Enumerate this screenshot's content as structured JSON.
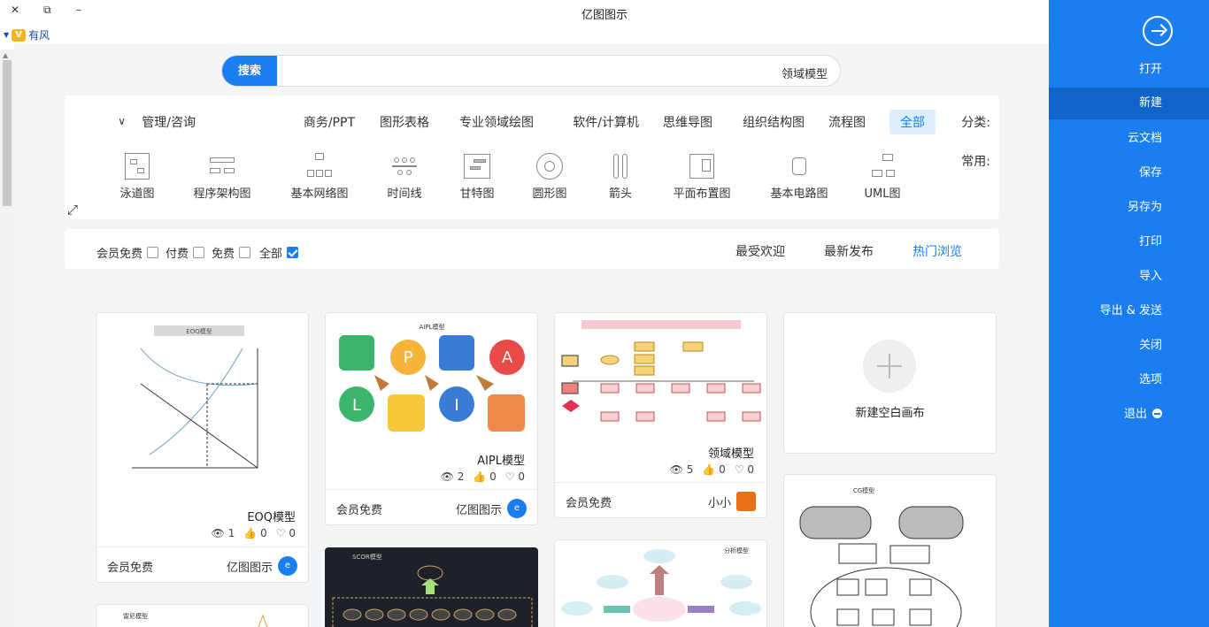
{
  "window": {
    "title": "亿图图示",
    "close": "✕",
    "restore": "⧉",
    "minimize": "–"
  },
  "brand": {
    "label": "有风",
    "logo": "V"
  },
  "search": {
    "button": "搜索",
    "query": "领域模型"
  },
  "categories": {
    "label": "分类:",
    "items": [
      "全部",
      "流程图",
      "组织结构图",
      "思维导图",
      "软件/计算机",
      "专业领域绘图",
      "图形表格",
      "商务/PPT",
      "管理/咨询"
    ],
    "more_icon": "chevron-down-icon"
  },
  "common": {
    "label": "常用:",
    "items": [
      "UML图",
      "基本电路图",
      "平面布置图",
      "箭头",
      "圆形图",
      "甘特图",
      "时间线",
      "基本网络图",
      "程序架构图",
      "泳道图"
    ]
  },
  "filters": {
    "tabs": [
      "热门浏览",
      "最新发布",
      "最受欢迎"
    ],
    "checks": [
      {
        "label": "全部",
        "checked": true
      },
      {
        "label": "免费",
        "checked": false
      },
      {
        "label": "付费",
        "checked": false
      },
      {
        "label": "会员免费",
        "checked": false
      }
    ]
  },
  "new_canvas": {
    "label": "新建空白画布"
  },
  "cards": [
    {
      "title": "领域模型",
      "views": "5",
      "likes": "0",
      "favs": "0",
      "author": "小小",
      "price": "会员免费"
    },
    {
      "title": "AIPL模型",
      "views": "2",
      "likes": "0",
      "favs": "0",
      "author": "亿图图示",
      "price": "会员免费"
    },
    {
      "title": "EOQ模型",
      "views": "1",
      "likes": "0",
      "favs": "0",
      "author": "亿图图示",
      "price": "会员免费"
    }
  ],
  "thumb_labels": {
    "eoq_header": "EOQ模型",
    "aipl_header": "AIPL模型",
    "scor_header": "SCOR模型",
    "analysis_header": "分析模型",
    "cg_header": "CG模型",
    "bottom_left_header": "雷尼模型"
  },
  "sidebar": {
    "items": [
      "打开",
      "新建",
      "云文档",
      "保存",
      "另存为",
      "打印",
      "导入",
      "导出 & 发送",
      "关闭",
      "选项",
      "退出"
    ],
    "active": "新建"
  }
}
